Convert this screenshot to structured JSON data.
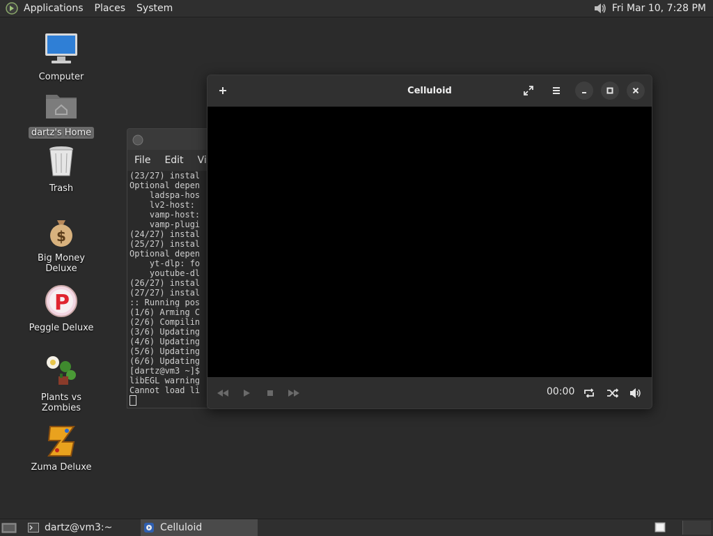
{
  "top_panel": {
    "menu": [
      "Applications",
      "Places",
      "System"
    ],
    "clock": "Fri Mar 10,  7:28 PM",
    "icons": [
      "app-menu-logo-icon",
      "volume-icon"
    ]
  },
  "desktop": {
    "icons": [
      {
        "label": "Computer",
        "icon": "computer-icon"
      },
      {
        "label": "dartz's Home",
        "icon": "home-folder-icon",
        "selected": true
      },
      {
        "label": "Trash",
        "icon": "trash-icon"
      },
      {
        "label": "Big Money Deluxe",
        "icon": "money-bag-icon"
      },
      {
        "label": "Peggle Deluxe",
        "icon": "peggle-icon"
      },
      {
        "label": "Plants vs Zombies",
        "icon": "plants-icon"
      },
      {
        "label": "Zuma Deluxe",
        "icon": "zuma-icon"
      }
    ]
  },
  "terminal": {
    "menu": [
      "File",
      "Edit",
      "Vie"
    ],
    "lines": [
      "(23/27) instal",
      "Optional depen",
      "    ladspa-hos",
      "    lv2-host: ",
      "    vamp-host:",
      "    vamp-plugi",
      "(24/27) instal",
      "(25/27) instal",
      "Optional depen",
      "    yt-dlp: fo",
      "    youtube-dl",
      "(26/27) instal",
      "(27/27) instal",
      ":: Running pos",
      "(1/6) Arming C",
      "(2/6) Compilin",
      "(3/6) Updating",
      "(4/6) Updating",
      "(5/6) Updating",
      "(6/6) Updating",
      "[dartz@vm3 ~]$",
      "libEGL warning",
      "Cannot load li"
    ]
  },
  "celluloid": {
    "title": "Celluloid",
    "time": "00:00",
    "header_icons": [
      "add-icon",
      "fullscreen-icon",
      "hamburger-menu-icon",
      "minimize-icon",
      "maximize-icon",
      "close-icon"
    ],
    "control_icons": [
      "rewind-icon",
      "play-icon",
      "stop-icon",
      "fast-forward-icon",
      "loop-icon",
      "shuffle-icon",
      "volume-icon"
    ]
  },
  "taskbar": {
    "tasks": [
      {
        "label": "dartz@vm3:~",
        "icon": "terminal-icon",
        "active": false
      },
      {
        "label": "Celluloid",
        "icon": "celluloid-icon",
        "active": true
      }
    ]
  }
}
